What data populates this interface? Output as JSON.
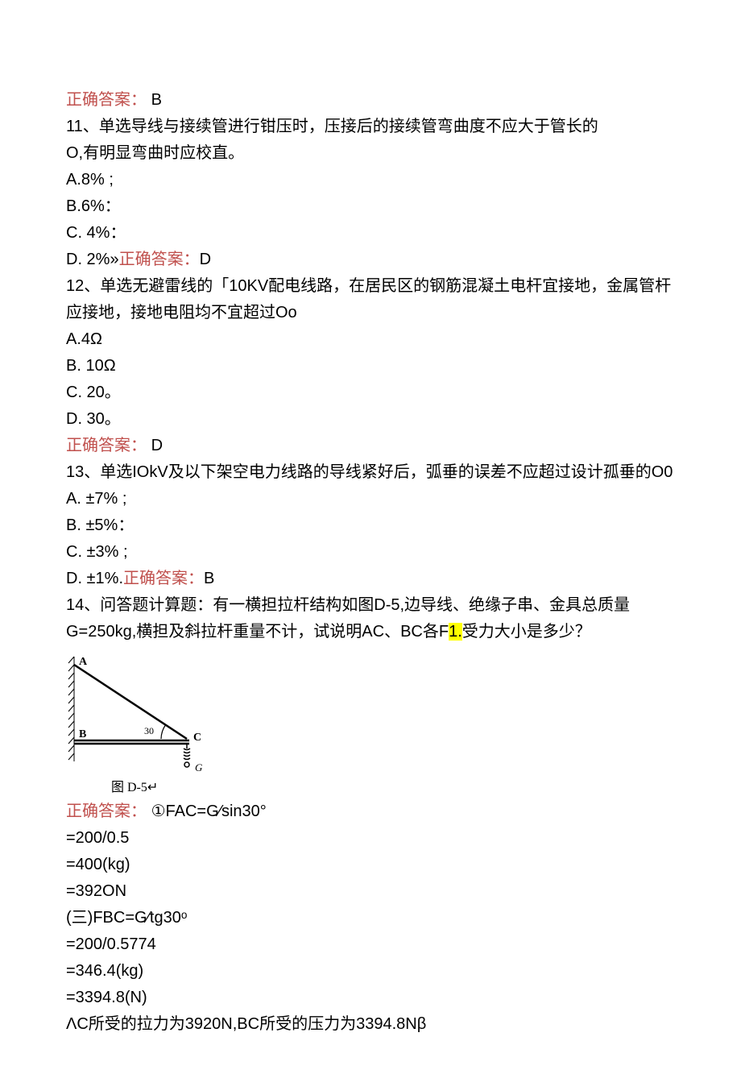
{
  "ans10_label": "正确答案：",
  "ans10_value": "B",
  "q11_line1": "11、单选导线与接续管进行钳压时，压接后的接续管弯曲度不应大于管长的",
  "q11_line2": " O,有明显弯曲时应校直。",
  "q11_a": "A.8% ;",
  "q11_b": "B.6%：",
  "q11_c": "C.   4%：",
  "q11_d_pre": "D.   2%»",
  "ans11_label": "正确答案：",
  "ans11_value": "D",
  "q12_line1": "12、单选无避雷线的「10KV配电线路，在居民区的钢筋混凝土电杆宜接地，金属管杆应接地，接地电阻均不宜超过Oo",
  "q12_a": "A.4Ω",
  "q12_b": "B.   10Ω",
  "q12_c": "C.   20。",
  "q12_d": "D.   30。",
  "ans12_label": "正确答案：",
  "ans12_value": "D",
  "q13_line1": "13、单选IOkV及以下架空电力线路的导线紧好后，弧垂的误差不应超过设计孤垂的O0",
  "q13_a": "A.   ±7% ;",
  "q13_b": "B.   ±5%：",
  "q13_c": "C.   ±3% ;",
  "q13_d_pre": "D.   ±1%.",
  "ans13_label": "正确答案：",
  "ans13_value": "B",
  "q14_line1_pre": "14、问答题计算题：有一横担拉杆结构如图D-5,边导线、绝缘子串、金具总质量G=250kg,横担及斜拉杆重量不计，试说明AC、BC各F",
  "q14_hl": "1.",
  "q14_line1_post": "受力大小是多少？",
  "fig_label_A": "A",
  "fig_label_B": "B",
  "fig_label_C": "C",
  "fig_label_G": "G",
  "fig_label_30": "30",
  "fig_caption": "图 D-5↵",
  "ans14_label": "正确答案：",
  "ans14_step1": "①FAC=G⁄sin30°",
  "ans14_s2": "=200/0.5",
  "ans14_s3": "=400(kg)",
  "ans14_s4": "=392ON",
  "ans14_s5": "(三)FBC=G⁄tg30ᵒ",
  "ans14_s6": "=200/0.5774",
  "ans14_s7": "=346.4(kg)",
  "ans14_s8": "=3394.8(N)",
  "ans14_s9": "ΛC所受的拉力为3920N,BC所受的压力为3394.8Nβ"
}
